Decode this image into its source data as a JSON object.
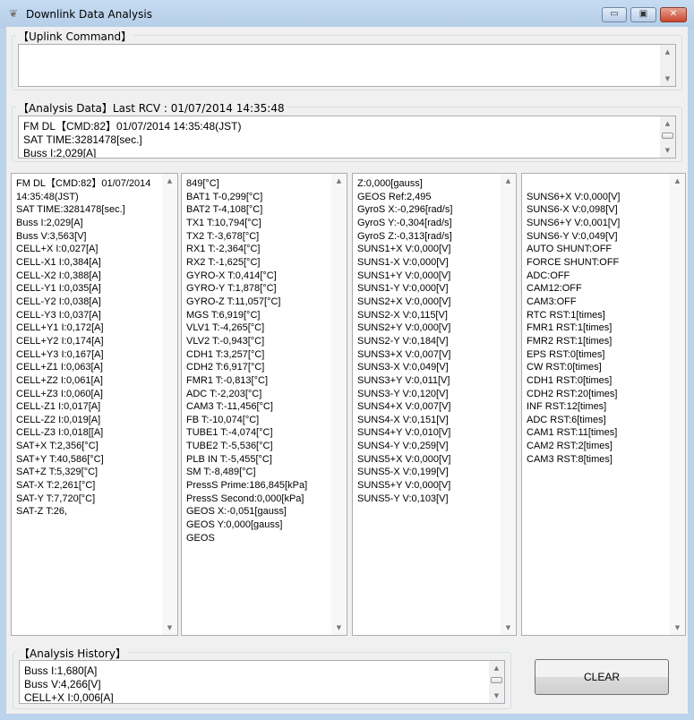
{
  "window": {
    "title": "Downlink Data Analysis",
    "icon": "sprout-icon",
    "controls": {
      "minimize": "▭",
      "maximize": "▣",
      "close": "✕"
    }
  },
  "uplink": {
    "label": "【Uplink Command】",
    "value": ""
  },
  "analysis": {
    "label": "【Analysis Data】Last RCV : 01/07/2014 14:35:48",
    "lines": "FM DL【CMD:82】01/07/2014 14:35:48(JST)\nSAT TIME:3281478[sec.]\nBuss I:2,029[A]"
  },
  "columns": [
    "FM DL【CMD:82】01/07/2014\n14:35:48(JST)\nSAT TIME:3281478[sec.]\nBuss I:2,029[A]\nBuss V:3,563[V]\nCELL+X I:0,027[A]\nCELL-X1 I:0,384[A]\nCELL-X2 I:0,388[A]\nCELL-Y1 I:0,035[A]\nCELL-Y2 I:0,038[A]\nCELL-Y3 I:0,037[A]\nCELL+Y1 I:0,172[A]\nCELL+Y2 I:0,174[A]\nCELL+Y3 I:0,167[A]\nCELL+Z1 I:0,063[A]\nCELL+Z2 I:0,061[A]\nCELL+Z3 I:0,060[A]\nCELL-Z1 I:0,017[A]\nCELL-Z2 I:0,019[A]\nCELL-Z3 I:0,018[[A]\nSAT+X T:2,356[°C]\nSAT+Y T:40,586[°C]\nSAT+Z T:5,329[°C]\nSAT-X T:2,261[°C]\nSAT-Y T:7,720[°C]\nSAT-Z T:26,",
    "849[°C]\nBAT1 T-0,299[°C]\nBAT2 T-4,108[°C]\nTX1 T:10,794[°C]\nTX2 T:-3,678[°C]\nRX1 T:-2,364[°C]\nRX2 T:-1,625[°C]\nGYRO-X T:0,414[°C]\nGYRO-Y T:1,878[°C]\nGYRO-Z T:11,057[°C]\nMGS T:6,919[°C]\nVLV1 T:-4,265[°C]\nVLV2 T:-0,943[°C]\nCDH1 T:3,257[°C]\nCDH2 T:6,917[°C]\nFMR1 T:-0,813[°C]\nADC T:-2,203[°C]\nCAM3 T:-11,456[°C]\nFB T:-10,074[°C]\nTUBE1 T:-4,074[°C]\nTUBE2 T:-5,536[°C]\nPLB IN T:-5,455[°C]\nSM T:-8,489[°C]\nPressS Prime:186,845[kPa]\nPressS Second:0,000[kPa]\nGEOS X:-0,051[gauss]\nGEOS Y:0,000[gauss]\nGEOS",
    "Z:0,000[gauss]\nGEOS Ref:2,495\nGyroS X:-0,296[rad/s]\nGyroS Y:-0,304[rad/s]\nGyroS Z:-0,313[rad/s]\nSUNS1+X V:0,000[V]\nSUNS1-X V:0,000[V]\nSUNS1+Y V:0,000[V]\nSUNS1-Y V:0,000[V]\nSUNS2+X V:0,000[V]\nSUNS2-X V:0,115[V]\nSUNS2+Y V:0,000[V]\nSUNS2-Y V:0,184[V]\nSUNS3+X V:0,007[V]\nSUNS3-X V:0,049[V]\nSUNS3+Y V:0,011[V]\nSUNS3-Y V:0,120[V]\nSUNS4+X V:0,007[V]\nSUNS4-X V:0,151[V]\nSUNS4+Y V:0,010[V]\nSUNS4-Y V:0,259[V]\nSUNS5+X V:0,000[V]\nSUNS5-X V:0,199[V]\nSUNS5+Y V:0,000[V]\nSUNS5-Y V:0,103[V]",
    "\nSUNS6+X V:0,000[V]\nSUNS6-X V:0,098[V]\nSUNS6+Y V:0,001[V]\nSUNS6-Y V:0,049[V]\nAUTO SHUNT:OFF\nFORCE SHUNT:OFF\nADC:OFF\nCAM12:OFF\nCAM3:OFF\nRTC RST:1[times]\nFMR1 RST:1[times]\nFMR2 RST:1[times]\nEPS RST:0[times]\nCW RST:0[times]\nCDH1 RST:0[times]\nCDH2 RST:20[times]\nINF RST:12[times]\nADC RST:6[times]\nCAM1 RST:11[times]\nCAM2 RST:2[times]\nCAM3 RST:8[times]"
  ],
  "history": {
    "label": "【Analysis History】",
    "lines": "Buss I:1,680[A]\nBuss V:4,266[V]\nCELL+X I:0,006[A]"
  },
  "clear_label": "CLEAR"
}
